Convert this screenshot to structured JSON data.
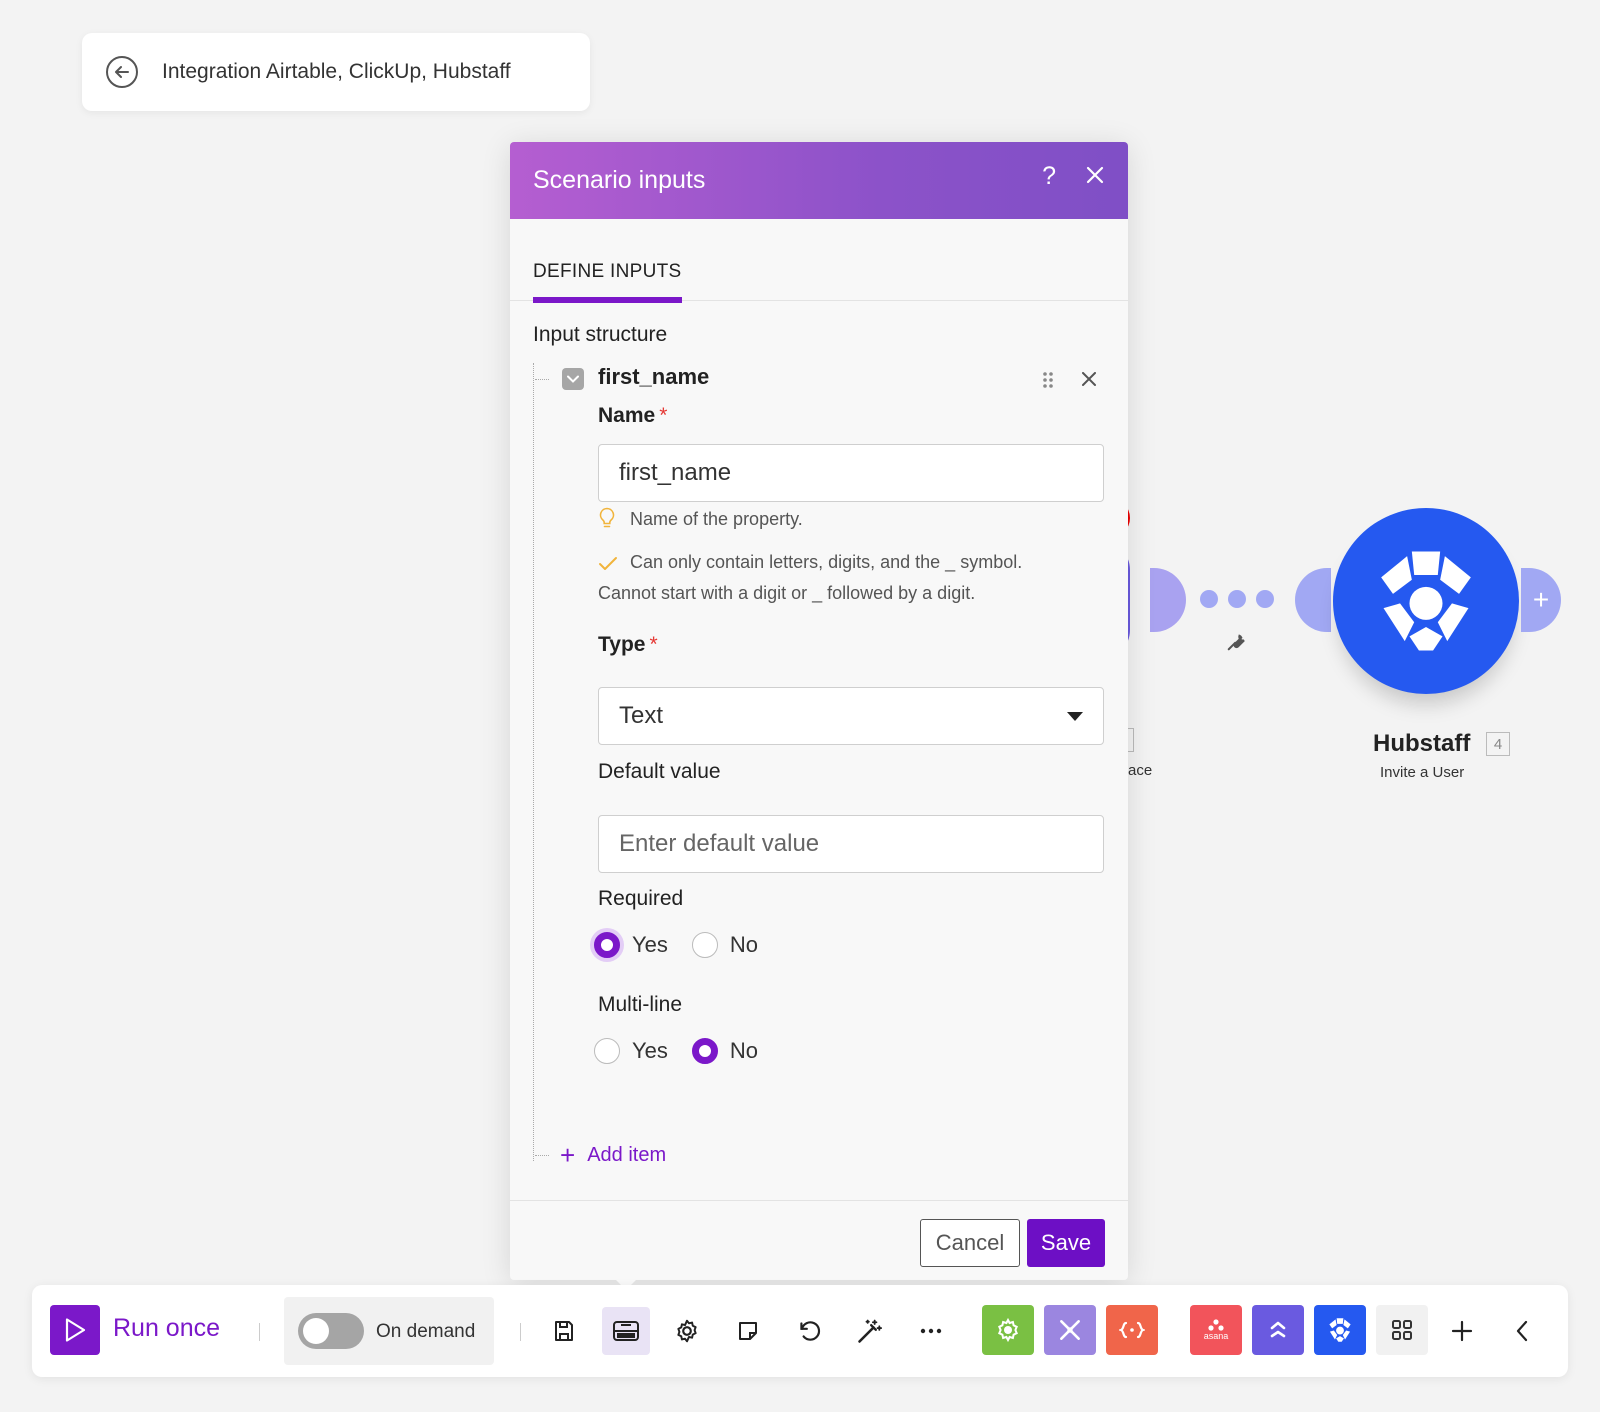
{
  "breadcrumb": {
    "title": "Integration Airtable, ClickUp, Hubstaff",
    "back_icon": "arrow-left-circle-icon"
  },
  "canvas": {
    "hubstaff_node": {
      "label": "Hubstaff",
      "badge": "4",
      "subtitle": "Invite a User",
      "color": "#2559f0"
    },
    "partial_node_label": "ace"
  },
  "modal": {
    "title": "Scenario inputs",
    "help_label": "?",
    "tabs": [
      {
        "label": "DEFINE INPUTS",
        "active": true
      }
    ],
    "section_label": "Input structure",
    "item": {
      "title": "first_name",
      "name_field": {
        "label": "Name",
        "required_mark": "*",
        "value": "first_name",
        "hint": "Name of the property.",
        "validation_line1": "Can only contain letters, digits, and the _ symbol.",
        "validation_line2": "Cannot start with a digit or _ followed by a digit."
      },
      "type_field": {
        "label": "Type",
        "required_mark": "*",
        "selected": "Text"
      },
      "default_field": {
        "label": "Default value",
        "placeholder": "Enter default value"
      },
      "required_field": {
        "label": "Required",
        "options": [
          "Yes",
          "No"
        ],
        "selected": "Yes"
      },
      "multiline_field": {
        "label": "Multi-line",
        "options": [
          "Yes",
          "No"
        ],
        "selected": "No"
      }
    },
    "add_item_label": "Add item",
    "cancel_label": "Cancel",
    "save_label": "Save",
    "accent_color": "#7b18c9"
  },
  "toolbar": {
    "run_label": "Run once",
    "schedule_label": "On demand",
    "schedule_enabled": false,
    "icons": [
      "save-icon",
      "scenario-inputs-icon",
      "settings-icon",
      "notes-icon",
      "undo-icon",
      "magic-wand-icon",
      "more-icon"
    ],
    "apps": [
      {
        "name": "tools",
        "color": "#7ac043"
      },
      {
        "name": "flow-control",
        "color": "#9b86e0"
      },
      {
        "name": "json",
        "color": "#f0654a"
      },
      {
        "name": "asana",
        "color": "#f2545b",
        "text": "asana"
      },
      {
        "name": "clickup",
        "color": "#6a5ae0"
      },
      {
        "name": "hubstaff",
        "color": "#2559f0"
      }
    ]
  }
}
